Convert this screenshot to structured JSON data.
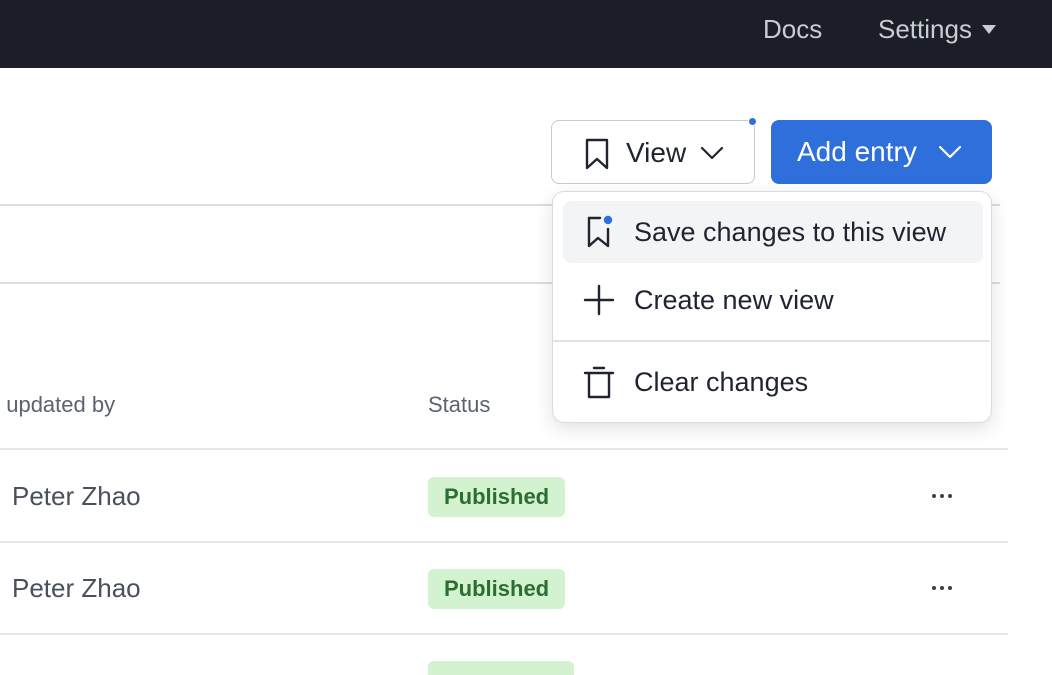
{
  "nav": {
    "docs_label": "Docs",
    "settings_label": "Settings"
  },
  "toolbar": {
    "view_label": "View",
    "view_has_unsaved_changes": true,
    "add_entry_label": "Add entry"
  },
  "view_menu": {
    "items": [
      {
        "label": "Save changes to this view",
        "icon": "bookmark-with-dot-icon",
        "highlighted": true
      },
      {
        "label": "Create new view",
        "icon": "plus-icon"
      },
      {
        "label": "Clear changes",
        "icon": "trash-icon"
      }
    ]
  },
  "table": {
    "columns": {
      "updated_by": "t updated by",
      "status": "Status"
    },
    "rows": [
      {
        "updated_by": "Peter Zhao",
        "status": "Published"
      },
      {
        "updated_by": "Peter Zhao",
        "status": "Published"
      }
    ],
    "row_menu_icon": "ellipsis-icon"
  },
  "colors": {
    "topbar_bg": "#1b1e27",
    "accent": "#2e6fdc",
    "badge_bg": "#d3f2cf",
    "badge_text": "#2c6d32"
  }
}
